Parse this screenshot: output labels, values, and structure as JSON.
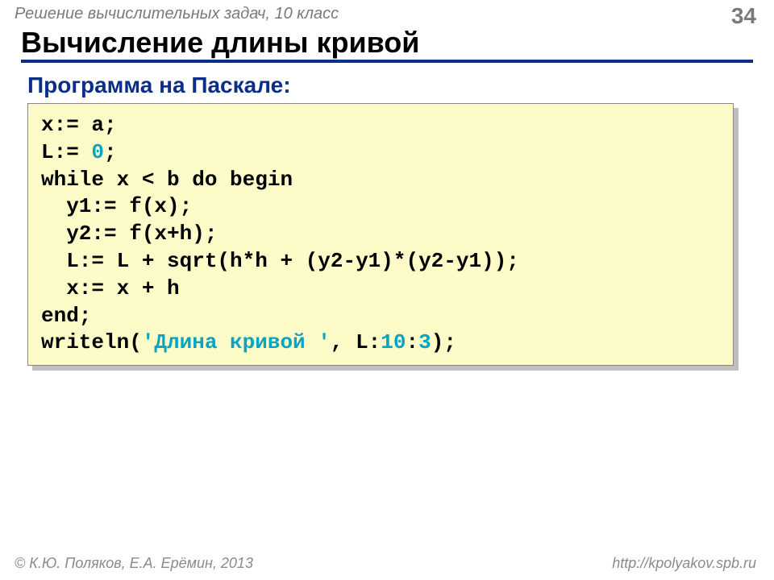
{
  "header": {
    "subject": "Решение  вычислительных задач, 10 класс",
    "page_number": "34"
  },
  "title": "Вычисление длины кривой",
  "subtitle": "Программа на Паскале:",
  "code": {
    "l1a": "x:= a;",
    "l2a": "L:= ",
    "l2b": "0",
    "l2c": ";",
    "l3a": "while x < b do begin",
    "l4a": "  y1:= f(x);",
    "l5a": "  y2:= f(x+h);",
    "l6a": "  L:= L + sqrt(h*h + (y2-y1)*(y2-y1));",
    "l7a": "  x:= x + h",
    "l8a": "end;",
    "l9a": "writeln(",
    "l9b": "'Длина кривой '",
    "l9c": ", L:",
    "l9d": "10",
    "l9e": ":",
    "l9f": "3",
    "l9g": ");"
  },
  "footer": {
    "left": "© К.Ю. Поляков, Е.А. Ерёмин, 2013",
    "right": "http://kpolyakov.spb.ru"
  }
}
